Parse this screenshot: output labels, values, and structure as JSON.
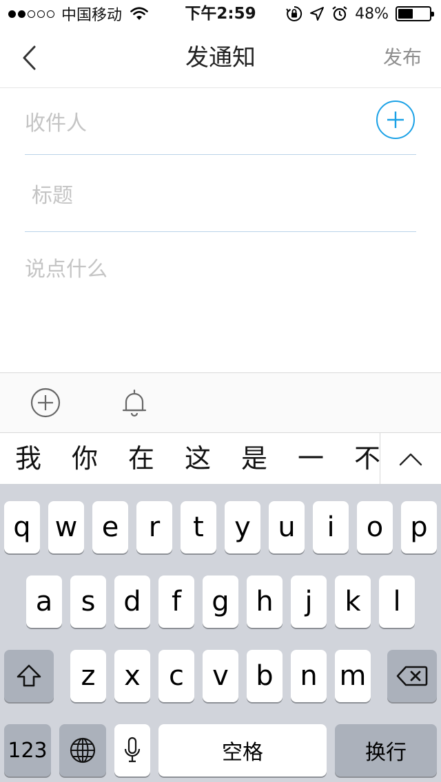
{
  "status_bar": {
    "carrier": "中国移动",
    "time": "下午2:59",
    "battery_percent": "48%",
    "battery_level": 0.48,
    "signal_strength": 2
  },
  "nav": {
    "title": "发通知",
    "publish_label": "发布"
  },
  "form": {
    "recipient_placeholder": "收件人",
    "title_placeholder": "标题",
    "body_placeholder": "说点什么"
  },
  "candidates": [
    "我",
    "你",
    "在",
    "这",
    "是",
    "一",
    "不"
  ],
  "keyboard": {
    "row1": [
      "q",
      "w",
      "e",
      "r",
      "t",
      "y",
      "u",
      "i",
      "o",
      "p"
    ],
    "row2": [
      "a",
      "s",
      "d",
      "f",
      "g",
      "h",
      "j",
      "k",
      "l"
    ],
    "row3": [
      "z",
      "x",
      "c",
      "v",
      "b",
      "n",
      "m"
    ],
    "numbers_label": "123",
    "space_label": "空格",
    "return_label": "换行"
  },
  "colors": {
    "accent": "#1aa1e6",
    "divider": "#b9d3e8",
    "placeholder": "#c4c4c4",
    "keyboard_bg": "#d1d4db",
    "dark_key": "#abb1bb"
  }
}
